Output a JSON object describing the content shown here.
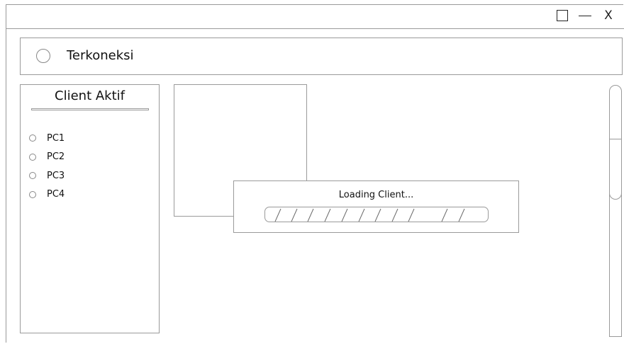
{
  "window": {
    "controls": {
      "close_label": "X"
    }
  },
  "status": {
    "label": "Terkoneksi"
  },
  "clients": {
    "title": "Client Aktif",
    "items": [
      {
        "label": "PC1"
      },
      {
        "label": "PC2"
      },
      {
        "label": "PC3"
      },
      {
        "label": "PC4"
      }
    ]
  },
  "loading": {
    "message": "Loading Client..."
  }
}
